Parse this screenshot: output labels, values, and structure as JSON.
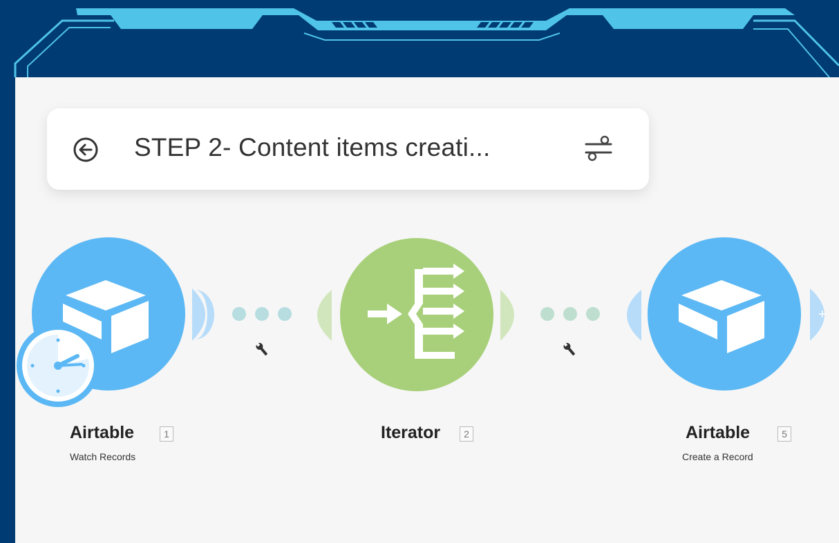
{
  "header": {
    "title": "STEP 2- Content items creati..."
  },
  "modules": [
    {
      "name": "Airtable",
      "id": "1",
      "subtitle": "Watch Records",
      "icon": "airtable-icon",
      "color": "#5cb8f4",
      "trigger": "clock-trigger-icon"
    },
    {
      "name": "Iterator",
      "id": "2",
      "subtitle": "",
      "icon": "iterator-icon",
      "color": "#a8d07a"
    },
    {
      "name": "Airtable",
      "id": "5",
      "subtitle": "Create a Record",
      "icon": "airtable-icon",
      "color": "#5cb8f4"
    }
  ],
  "colors": {
    "frame": "#003b73",
    "frame_accent": "#4fc3e8",
    "canvas": "#f6f6f6",
    "airtable": "#5cb8f4",
    "iterator": "#a8d07a"
  }
}
